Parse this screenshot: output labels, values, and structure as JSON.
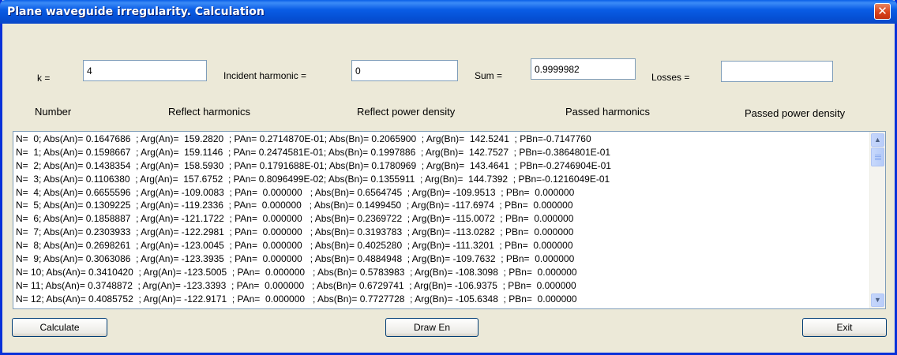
{
  "window": {
    "title": "Plane waveguide irregularity. Calculation",
    "close_symbol": "✕"
  },
  "fields": {
    "k_label": "k =",
    "k_value": "4",
    "incident_label": "Incident harmonic =",
    "incident_value": "0",
    "sum_label": "Sum =",
    "sum_value": "0.9999982",
    "losses_label": "Losses =",
    "losses_value": ""
  },
  "headers": {
    "number": "Number",
    "reflect_harmonics": "Reflect harmonics",
    "reflect_power": "Reflect power density",
    "passed_harmonics": "Passed harmonics",
    "passed_power": "Passed power density"
  },
  "results": [
    "N=  0; Abs(An)= 0.1647686  ; Arg(An)=  159.2820  ; PAn= 0.2714870E-01; Abs(Bn)= 0.2065900  ; Arg(Bn)=  142.5241  ; PBn=-0.7147760",
    "N=  1; Abs(An)= 0.1598667  ; Arg(An)=  159.1146  ; PAn= 0.2474581E-01; Abs(Bn)= 0.1997886  ; Arg(Bn)=  142.7527  ; PBn=-0.3864801E-01",
    "N=  2; Abs(An)= 0.1438354  ; Arg(An)=  158.5930  ; PAn= 0.1791688E-01; Abs(Bn)= 0.1780969  ; Arg(Bn)=  143.4641  ; PBn=-0.2746904E-01",
    "N=  3; Abs(An)= 0.1106380  ; Arg(An)=  157.6752  ; PAn= 0.8096499E-02; Abs(Bn)= 0.1355911  ; Arg(Bn)=  144.7392  ; PBn=-0.1216049E-01",
    "N=  4; Abs(An)= 0.6655596  ; Arg(An)= -109.0083  ; PAn=  0.000000   ; Abs(Bn)= 0.6564745  ; Arg(Bn)= -109.9513  ; PBn=  0.000000",
    "N=  5; Abs(An)= 0.1309225  ; Arg(An)= -119.2336  ; PAn=  0.000000   ; Abs(Bn)= 0.1499450  ; Arg(Bn)= -117.6974  ; PBn=  0.000000",
    "N=  6; Abs(An)= 0.1858887  ; Arg(An)= -121.1722  ; PAn=  0.000000   ; Abs(Bn)= 0.2369722  ; Arg(Bn)= -115.0072  ; PBn=  0.000000",
    "N=  7; Abs(An)= 0.2303933  ; Arg(An)= -122.2981  ; PAn=  0.000000   ; Abs(Bn)= 0.3193783  ; Arg(Bn)= -113.0282  ; PBn=  0.000000",
    "N=  8; Abs(An)= 0.2698261  ; Arg(An)= -123.0045  ; PAn=  0.000000   ; Abs(Bn)= 0.4025280  ; Arg(Bn)= -111.3201  ; PBn=  0.000000",
    "N=  9; Abs(An)= 0.3063086  ; Arg(An)= -123.3935  ; PAn=  0.000000   ; Abs(Bn)= 0.4884948  ; Arg(Bn)= -109.7632  ; PBn=  0.000000",
    "N= 10; Abs(An)= 0.3410420  ; Arg(An)= -123.5005  ; PAn=  0.000000   ; Abs(Bn)= 0.5783983  ; Arg(Bn)= -108.3098  ; PBn=  0.000000",
    "N= 11; Abs(An)= 0.3748872  ; Arg(An)= -123.3393  ; PAn=  0.000000   ; Abs(Bn)= 0.6729741  ; Arg(Bn)= -106.9375  ; PBn=  0.000000",
    "N= 12; Abs(An)= 0.4085752  ; Arg(An)= -122.9171  ; PAn=  0.000000   ; Abs(Bn)= 0.7727728  ; Arg(Bn)= -105.6348  ; PBn=  0.000000"
  ],
  "buttons": {
    "calculate": "Calculate",
    "draw": "Draw En",
    "exit": "Exit"
  },
  "icons": {
    "scroll_up": "▲",
    "scroll_down": "▼"
  }
}
